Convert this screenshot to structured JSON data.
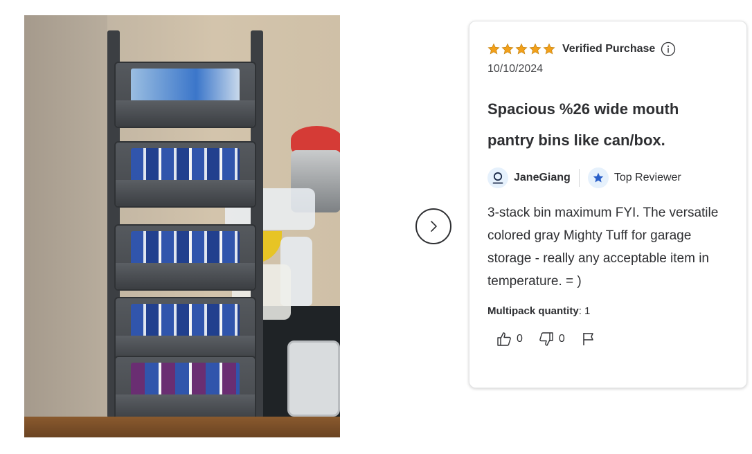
{
  "review": {
    "rating_stars": 5,
    "verified_label": "Verified Purchase",
    "date": "10/10/2024",
    "title": "Spacious %26 wide mouth pantry bins like can/box.",
    "author": "JaneGiang",
    "badge": "Top Reviewer",
    "body": "3-stack bin maximum FYI. The versatile colored gray Mighty Tuff for garage storage - really any acceptable item in temperature. = )",
    "multipack_label": "Multipack quantity",
    "multipack_value": "1",
    "helpful_count": "0",
    "unhelpful_count": "0"
  },
  "colors": {
    "star": "#f2a01a",
    "accent_blue": "#2a5fc8",
    "avatar_bg": "#e6f1fc",
    "text": "#2e2f32"
  }
}
